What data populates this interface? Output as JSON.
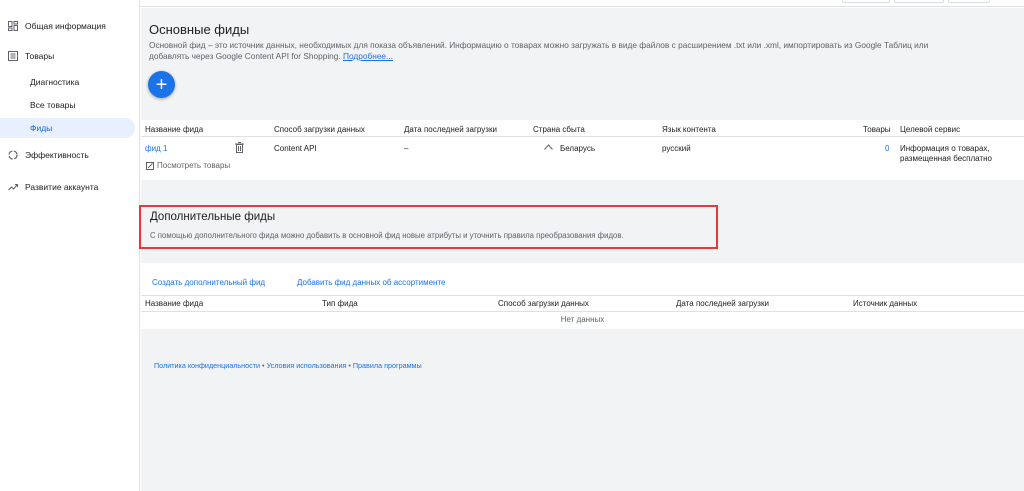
{
  "sidebar": {
    "overview": {
      "label": "Общая информация",
      "icon": "dashboard-icon"
    },
    "products": {
      "label": "Товары",
      "icon": "products-icon"
    },
    "sub_items": [
      {
        "label": "Диагностика"
      },
      {
        "label": "Все товары"
      },
      {
        "label": "Фиды",
        "active": true
      }
    ],
    "performance": {
      "label": "Эффективность",
      "icon": "performance-icon"
    },
    "growth": {
      "label": "Развитие аккаунта",
      "icon": "trending-up-icon"
    }
  },
  "primary": {
    "title": "Основные фиды",
    "description_line1": "Основной фид – это источник данных, необходимых для показа объявлений. Информацию о товарах можно загружать в виде файлов с расширением .txt или .xml, импортировать из Google Таблиц или",
    "description_line2": "добавлять через Google Content API for Shopping.",
    "learn_more": "Подробнее...",
    "add_button": "+",
    "columns": {
      "name": "Название фида",
      "method": "Способ загрузки данных",
      "last_upload": "Дата последней загрузки",
      "country": "Страна сбыта",
      "language": "Язык контента",
      "products": "Товары",
      "destination": "Целевой сервис"
    },
    "row": {
      "name": "фид 1",
      "method": "Content API",
      "last_upload": "–",
      "country": "Беларусь",
      "language": "русский",
      "products": "0",
      "destination_line1": "Информация о товарах,",
      "destination_line2": "размещенная бесплатно",
      "view_products": "Посмотреть товары"
    }
  },
  "supplemental": {
    "title": "Дополнительные фиды",
    "description": "С помощью дополнительного фида можно добавить в основной фид новые атрибуты и уточнить правила преобразования фидов.",
    "create_link": "Создать дополнительный фид",
    "add_inventory_link": "Добавить фид данных об ассортименте",
    "columns": {
      "name": "Название фида",
      "type": "Тип фида",
      "method": "Способ загрузки данных",
      "last_upload": "Дата последней загрузки",
      "source": "Источник данных"
    },
    "empty": "Нет данных"
  },
  "footer": {
    "privacy": "Политика конфиденциальности",
    "terms": "Условия использования",
    "program": "Правила программы",
    "separator": "•"
  },
  "colors": {
    "accent": "#1a73e8",
    "highlight": "#e53935",
    "active_bg": "#e8f0fe"
  }
}
